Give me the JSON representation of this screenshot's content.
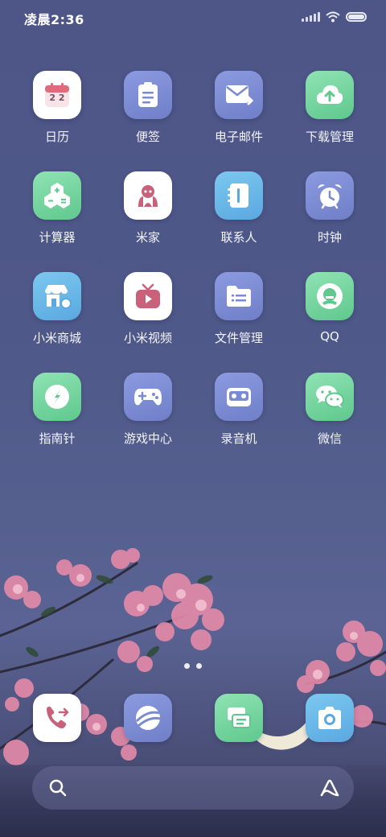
{
  "status_bar": {
    "time": "凌晨2:36",
    "icons": [
      "signal-icon",
      "wifi-icon",
      "battery-icon"
    ]
  },
  "apps": [
    {
      "name": "app-calendar",
      "label": "日历",
      "icon": "calendar-icon",
      "style": "white",
      "day": "2 2"
    },
    {
      "name": "app-notes",
      "label": "便签",
      "icon": "notes-icon",
      "style": "blue"
    },
    {
      "name": "app-email",
      "label": "电子邮件",
      "icon": "mail-icon",
      "style": "blue"
    },
    {
      "name": "app-downloads",
      "label": "下载管理",
      "icon": "cloud-upload-icon",
      "style": "green"
    },
    {
      "name": "app-calculator",
      "label": "计算器",
      "icon": "calculator-icon",
      "style": "green"
    },
    {
      "name": "app-mijia",
      "label": "米家",
      "icon": "mijia-icon",
      "style": "white"
    },
    {
      "name": "app-contacts",
      "label": "联系人",
      "icon": "contacts-book-icon",
      "style": "sky"
    },
    {
      "name": "app-clock",
      "label": "时钟",
      "icon": "alarm-clock-icon",
      "style": "blue"
    },
    {
      "name": "app-mi-store",
      "label": "小米商城",
      "icon": "store-icon",
      "style": "sky"
    },
    {
      "name": "app-mi-video",
      "label": "小米视频",
      "icon": "tv-play-icon",
      "style": "white"
    },
    {
      "name": "app-file-manager",
      "label": "文件管理",
      "icon": "folder-icon",
      "style": "blue"
    },
    {
      "name": "app-qq",
      "label": "QQ",
      "icon": "qq-penguin-icon",
      "style": "green"
    },
    {
      "name": "app-compass",
      "label": "指南针",
      "icon": "compass-icon",
      "style": "green"
    },
    {
      "name": "app-game-center",
      "label": "游戏中心",
      "icon": "gamepad-icon",
      "style": "blue"
    },
    {
      "name": "app-recorder",
      "label": "录音机",
      "icon": "cassette-icon",
      "style": "blue"
    },
    {
      "name": "app-wechat",
      "label": "微信",
      "icon": "wechat-icon",
      "style": "green"
    }
  ],
  "page_indicator": {
    "pages": 2,
    "current": 1
  },
  "dock": [
    {
      "name": "dock-phone",
      "icon": "phone-call-icon",
      "style": "white"
    },
    {
      "name": "dock-browser",
      "icon": "browser-globe-icon",
      "style": "blue"
    },
    {
      "name": "dock-messages",
      "icon": "messages-icon",
      "style": "green"
    },
    {
      "name": "dock-camera",
      "icon": "camera-icon",
      "style": "sky"
    }
  ],
  "search_bar": {
    "left_icon": "search-icon",
    "right_icon": "xiaoai-assistant-icon"
  },
  "colors": {
    "accent_pink": "#e58aa8",
    "calendar_red": "#e06b7d",
    "blue_tile": "#7b8ad4",
    "green_tile": "#6fd29b"
  }
}
